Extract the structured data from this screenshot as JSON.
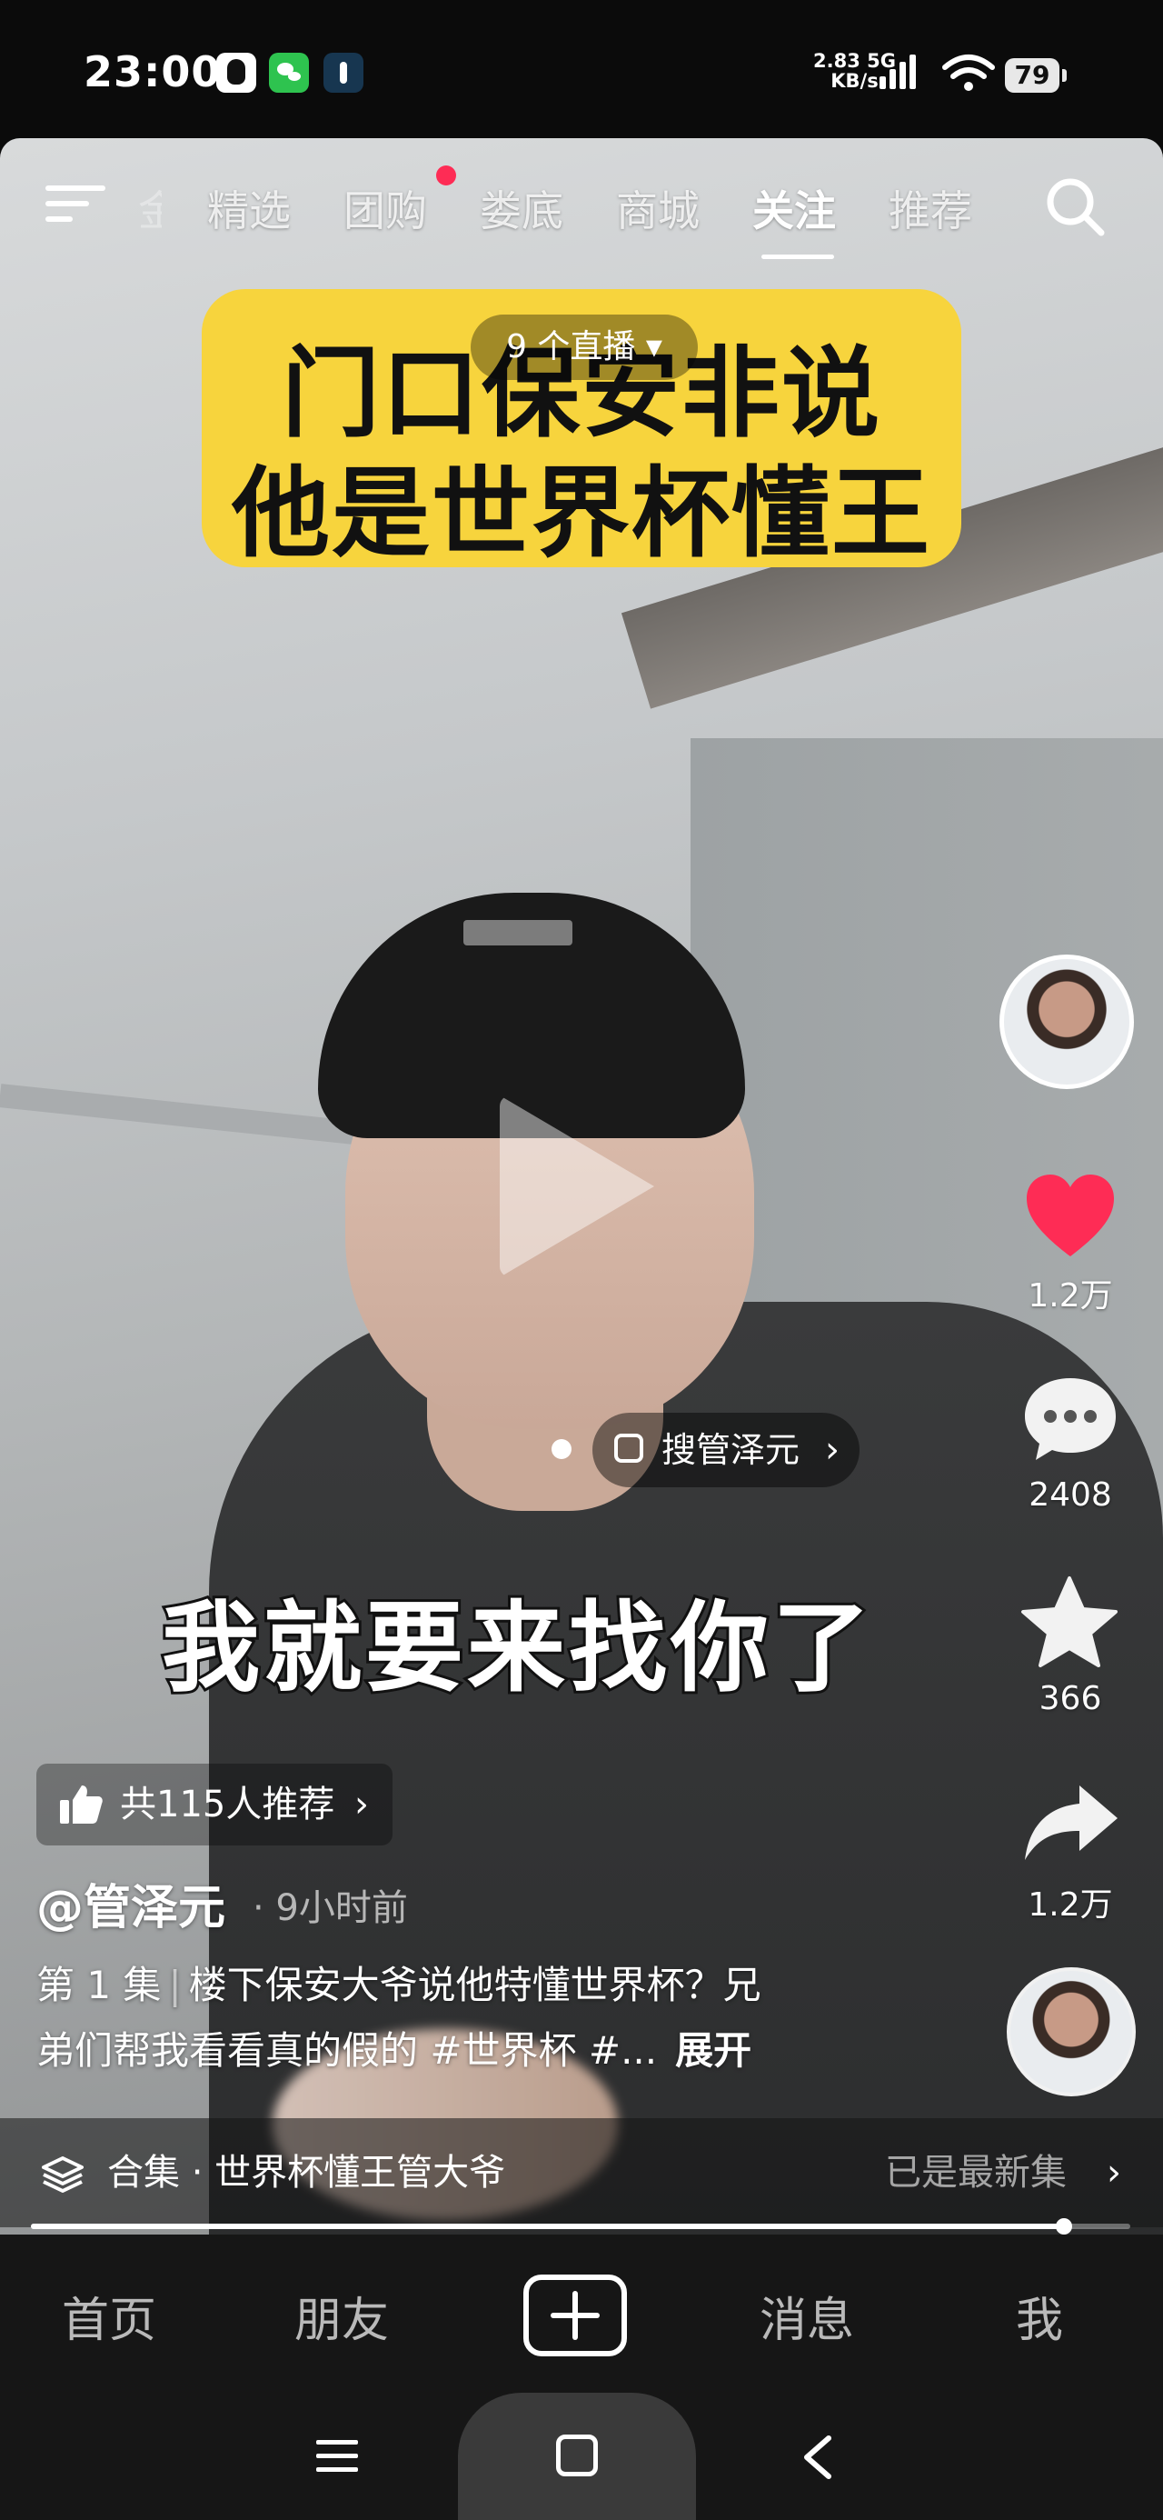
{
  "status_bar": {
    "time": "23:00",
    "net_speed_value": "2.83",
    "net_speed_unit": "KB/s",
    "network": "5G",
    "battery": "79",
    "app_icons": [
      "qq-icon",
      "wechat-icon",
      "notification-app-icon"
    ]
  },
  "top_tabs": {
    "faded_tab": "金",
    "items": [
      "精选",
      "团购",
      "娄底",
      "商城",
      "关注",
      "推荐"
    ],
    "active": "关注"
  },
  "video": {
    "title_line1": "门口保安非说",
    "title_line2": "他是世界杯懂王",
    "live_pill": "9 个直播 ▾",
    "caption": "我就要来找你了",
    "search_pill": "搜管泽元"
  },
  "actions": {
    "likes": "1.2万",
    "comments": "2408",
    "favorites": "366",
    "shares": "1.2万"
  },
  "post": {
    "recommend": "共115人推荐",
    "author": "@管泽元",
    "time_ago": "· 9小时前",
    "episode": "第 1 集",
    "description_line1_rest": "楼下保安大爷说他特懂世界杯？兄",
    "description_line2": "弟们帮我看看真的假的 #世界杯 #...",
    "expand": "展开",
    "progress_fraction": 0.94
  },
  "collection": {
    "label": "合集 · 世界杯懂王管大爷",
    "status": "已是最新集"
  },
  "bottom_nav": {
    "home": "首页",
    "friends": "朋友",
    "messages": "消息",
    "me": "我"
  },
  "colors": {
    "accent_red": "#fe2c55",
    "title_card": "#f7d43d"
  }
}
